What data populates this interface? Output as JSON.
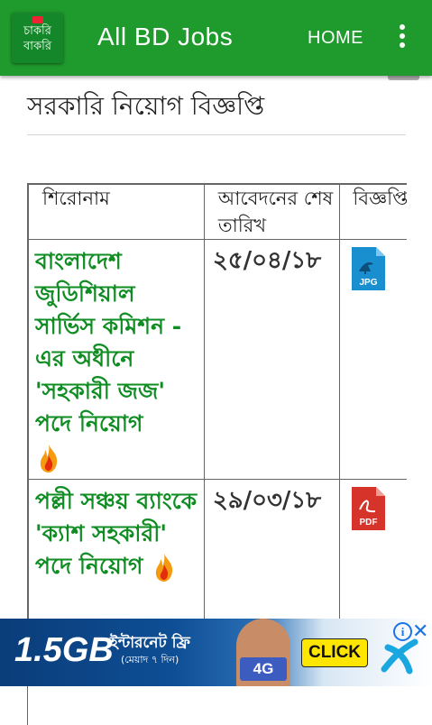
{
  "appbar": {
    "logo_line1": "চাকরি",
    "logo_line2": "বাকরি",
    "title": "All BD Jobs",
    "home_label": "HOME",
    "menu_icon": "overflow-menu-icon",
    "color": "#1f9a2c"
  },
  "page": {
    "heading": "সরকারি নিয়োগ বিজ্ঞপ্তি"
  },
  "table": {
    "headers": [
      "শিরোনাম",
      "আবেদনের শেষ তারিখ",
      "বিজ্ঞপ্তি"
    ],
    "rows": [
      {
        "title": "বাংলাদেশ জুডিশিয়াল সার্ভিস কমিশন - এর অধীনে 'সহকারী জজ' পদে নিয়োগ",
        "deadline": "২৫/০৪/১৮",
        "file_type": "JPG",
        "file_icon": "jpg-file-icon",
        "new_icon": "fire-icon"
      },
      {
        "title": "পল্লী সঞ্চয় ব্যাংকে 'ক্যাশ সহকারী' পদে নিয়োগ",
        "deadline": "২৯/০৩/১৮",
        "file_type": "PDF",
        "file_icon": "pdf-file-icon",
        "new_icon": "fire-icon"
      }
    ],
    "link_color": "#0f8c22"
  },
  "ad": {
    "data": "1.5GB",
    "offer": "ইন্টারনেট ফ্রি",
    "validity": "(মেয়াদ ৭ দিন)",
    "network": "4G",
    "cta": "CLICK",
    "info_icon": "info-icon",
    "close_icon": "close-icon"
  }
}
